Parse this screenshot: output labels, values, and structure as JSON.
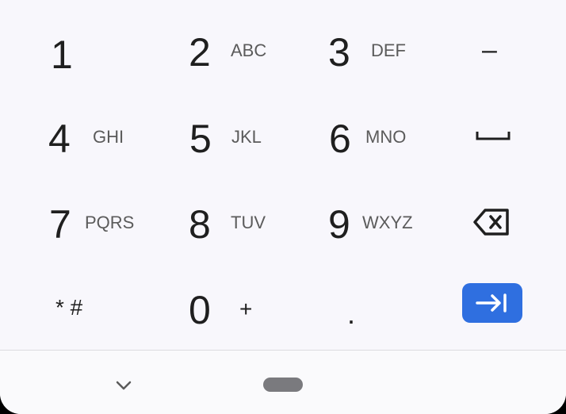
{
  "keys": {
    "k1": {
      "digit": "1"
    },
    "k2": {
      "digit": "2",
      "letters": "ABC"
    },
    "k3": {
      "digit": "3",
      "letters": "DEF"
    },
    "minus": {
      "label": "–"
    },
    "k4": {
      "digit": "4",
      "letters": "GHI"
    },
    "k5": {
      "digit": "5",
      "letters": "JKL"
    },
    "k6": {
      "digit": "6",
      "letters": "MNO"
    },
    "k7": {
      "digit": "7",
      "letters": "PQRS"
    },
    "k8": {
      "digit": "8",
      "letters": "TUV"
    },
    "k9": {
      "digit": "9",
      "letters": "WXYZ"
    },
    "star_hash": {
      "label": "* #"
    },
    "k0": {
      "digit": "0",
      "letters": "+"
    },
    "period": {
      "label": "."
    }
  },
  "icons": {
    "space": "space-bar-icon",
    "backspace": "backspace-icon",
    "tab": "tab-next-icon",
    "hide": "chevron-down-icon",
    "home": "home-pill-handle"
  },
  "colors": {
    "keyboard_bg": "#f8f7fc",
    "accent": "#2f6fe0",
    "text": "#1f1f1f",
    "subtext": "#5b5b5b"
  }
}
